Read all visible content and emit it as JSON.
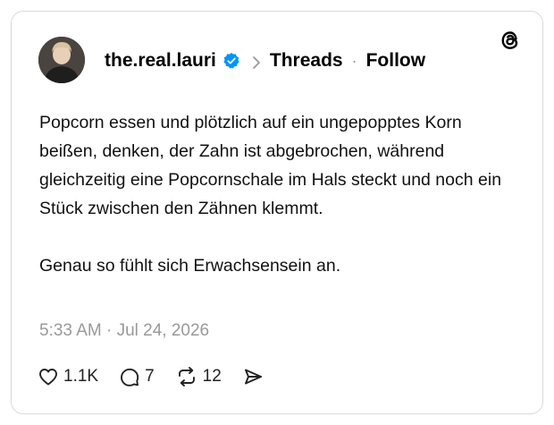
{
  "header": {
    "username": "the.real.lauri",
    "channel": "Threads",
    "separator": "·",
    "follow_label": "Follow",
    "verified_icon": "verified-badge-icon",
    "app_icon": "threads-logo-icon"
  },
  "post": {
    "paragraphs": [
      "Popcorn essen und plötzlich auf ein ungepopptes Korn beißen, denken, der Zahn ist abgebrochen, während gleichzeitig eine Popcornschale im Hals steckt und noch ein Stück zwischen den Zähnen klemmt.",
      "Genau so fühlt sich Erwachsensein an."
    ],
    "timestamp": "5:33 AM · Jul 24, 2026"
  },
  "actions": {
    "likes": "1.1K",
    "replies": "7",
    "reposts": "12"
  },
  "colors": {
    "verified": "#0095f6",
    "muted": "#999999",
    "border": "#d9d9d9"
  }
}
